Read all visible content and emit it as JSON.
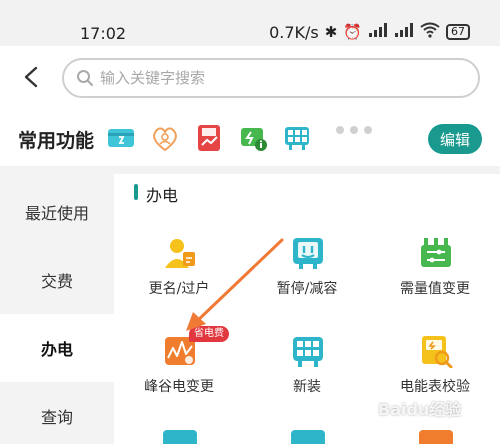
{
  "status_bar": {
    "time": "17:02",
    "network_speed": "0.7K/s",
    "battery": "67",
    "icons": [
      "bluetooth-icon",
      "alarm-icon",
      "signal-hd-icon",
      "signal-hd-icon",
      "wifi-icon",
      "battery-icon"
    ]
  },
  "header": {
    "back_icon": "back-arrow-icon",
    "search": {
      "placeholder": "输入关键字搜索",
      "value": ""
    }
  },
  "common": {
    "title": "常用功能",
    "icons": [
      "payment-card-icon",
      "heart-user-icon",
      "discount-bill-icon",
      "power-info-icon",
      "meter-grid-icon"
    ],
    "more_icon": "more-dots-icon",
    "edit_label": "编辑"
  },
  "sidebar": {
    "items": [
      {
        "label": "最近使用",
        "active": false
      },
      {
        "label": "交费",
        "active": false
      },
      {
        "label": "办电",
        "active": true
      },
      {
        "label": "查询",
        "active": false
      }
    ]
  },
  "main": {
    "section_title": "办电",
    "items": [
      {
        "label": "更名/过户",
        "icon": "user-change-icon"
      },
      {
        "label": "暂停/减容",
        "icon": "pause-meter-icon"
      },
      {
        "label": "需量值变更",
        "icon": "demand-adjust-icon"
      },
      {
        "label": "峰谷电变更",
        "icon": "peak-valley-icon",
        "badge": "省电费"
      },
      {
        "label": "新装",
        "icon": "new-install-icon"
      },
      {
        "label": "电能表校验",
        "icon": "meter-check-icon"
      }
    ]
  },
  "colors": {
    "accent": "#1a9a8e",
    "badge": "#e0383e",
    "annotation_arrow": "#f07a35"
  },
  "watermark": "Baidu经验"
}
